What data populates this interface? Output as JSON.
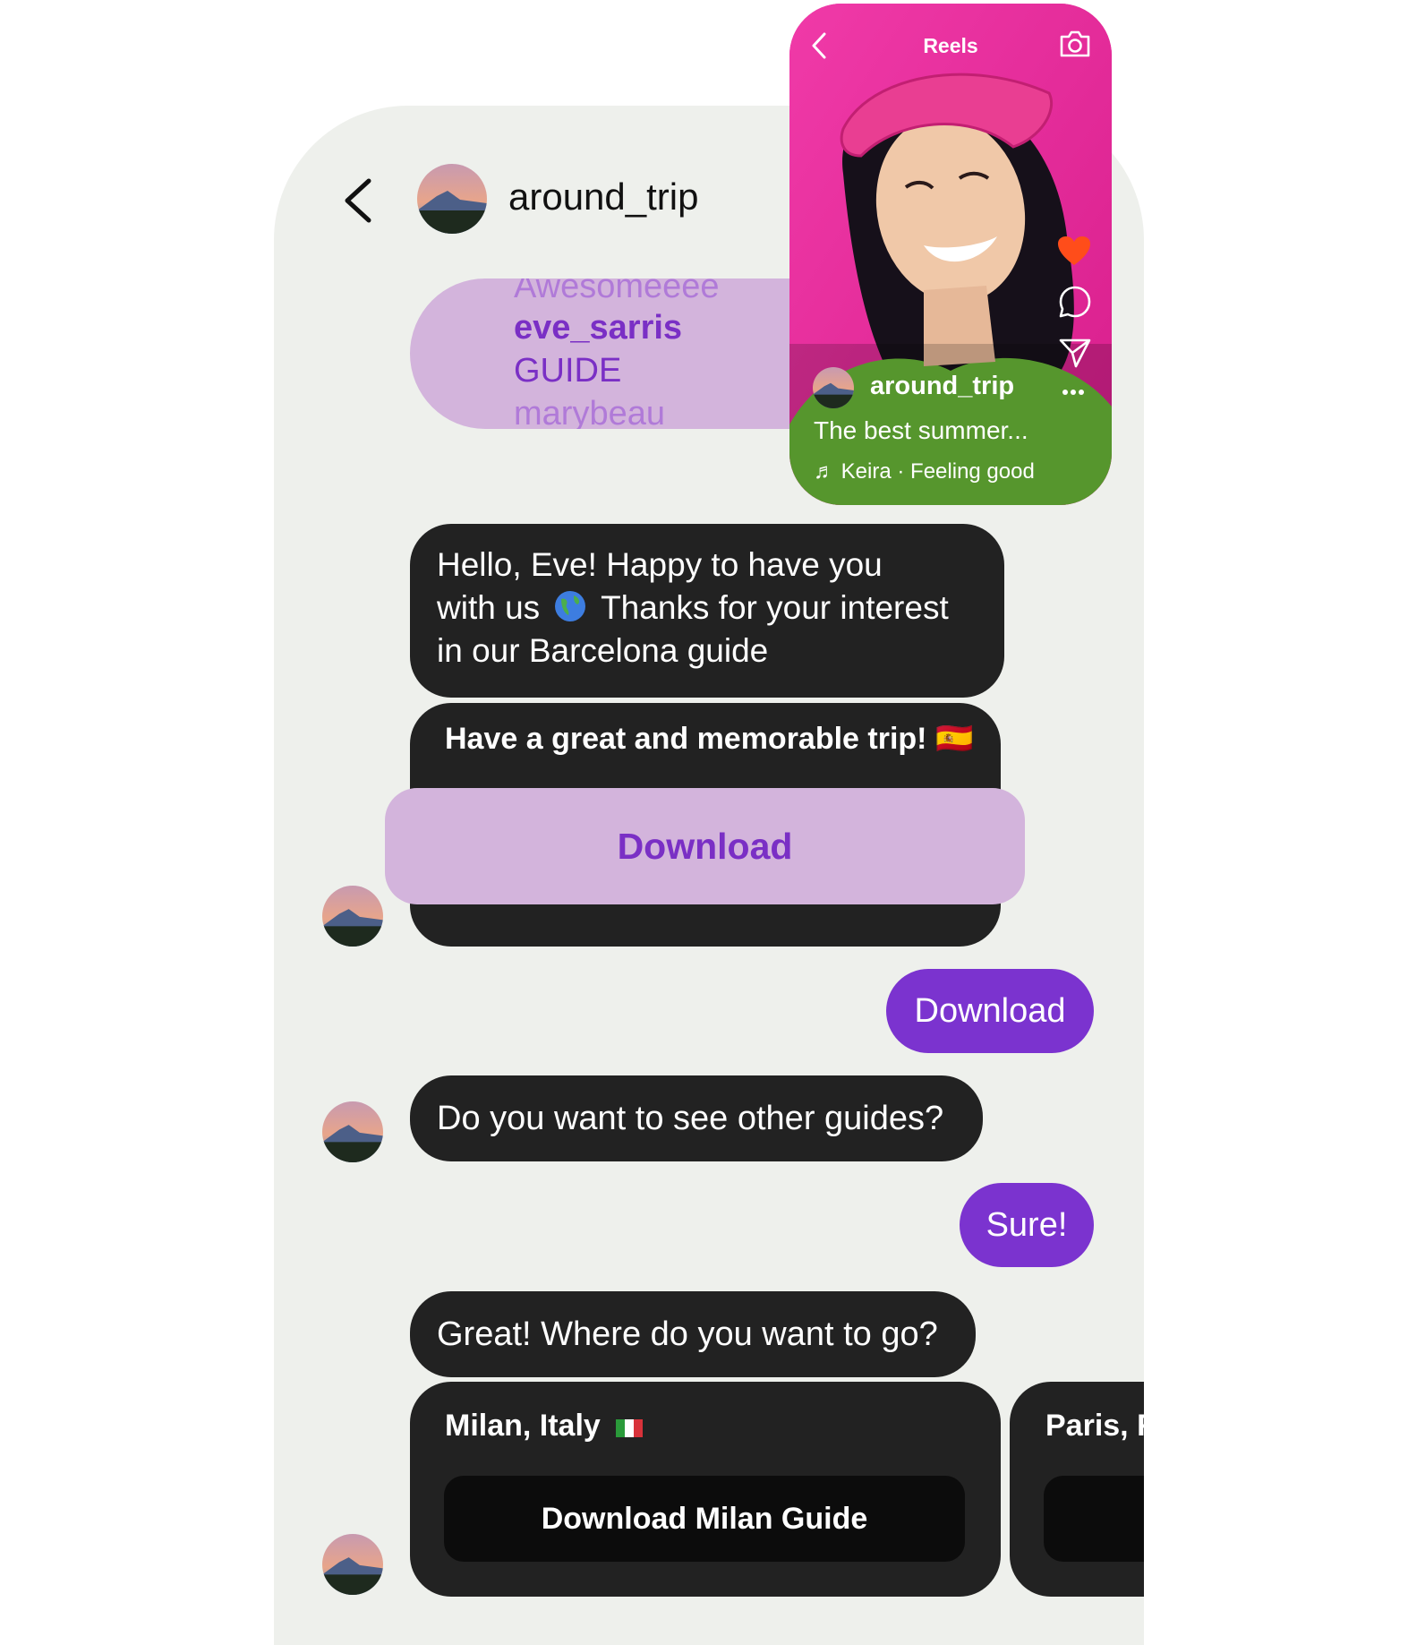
{
  "chat": {
    "contact_name": "around_trip",
    "shared_card": {
      "line1": "Awesomeeee",
      "line2": "eve_sarris",
      "line3": "GUIDE",
      "line4": "marybeau"
    },
    "messages": [
      {
        "from": "bot",
        "text": "Hello, Eve! Happy to have you with us 🌎 Thanks for your interest in our Barcelona guide"
      },
      {
        "from": "bot",
        "text": "Have a great and memorable trip! 🇪🇸",
        "button": "Download"
      },
      {
        "from": "user",
        "text": "Download"
      },
      {
        "from": "bot",
        "text": "Do you want to see other guides?"
      },
      {
        "from": "user",
        "text": "Sure!"
      },
      {
        "from": "bot",
        "text": "Great! Where do you want to go?"
      }
    ],
    "msg1_lines": [
      "Hello, Eve! Happy to have you",
      "with us",
      "Thanks for your interest",
      "in our Barcelona guide"
    ],
    "guides": [
      {
        "title": "Milan, Italy",
        "button": "Download Milan Guide"
      },
      {
        "title": "Paris, F",
        "button": ""
      }
    ]
  },
  "reel": {
    "title": "Reels",
    "username": "around_trip",
    "caption": "The best summer...",
    "artist": "Keira",
    "song": "Feeling good"
  },
  "colors": {
    "accent_purple": "#7b33cf",
    "light_purple": "#d3b4dc",
    "dark_bubble": "#222222",
    "background": "#eef0ec",
    "reel_pink": "#ea2f9f",
    "heart": "#ff4d1a"
  }
}
